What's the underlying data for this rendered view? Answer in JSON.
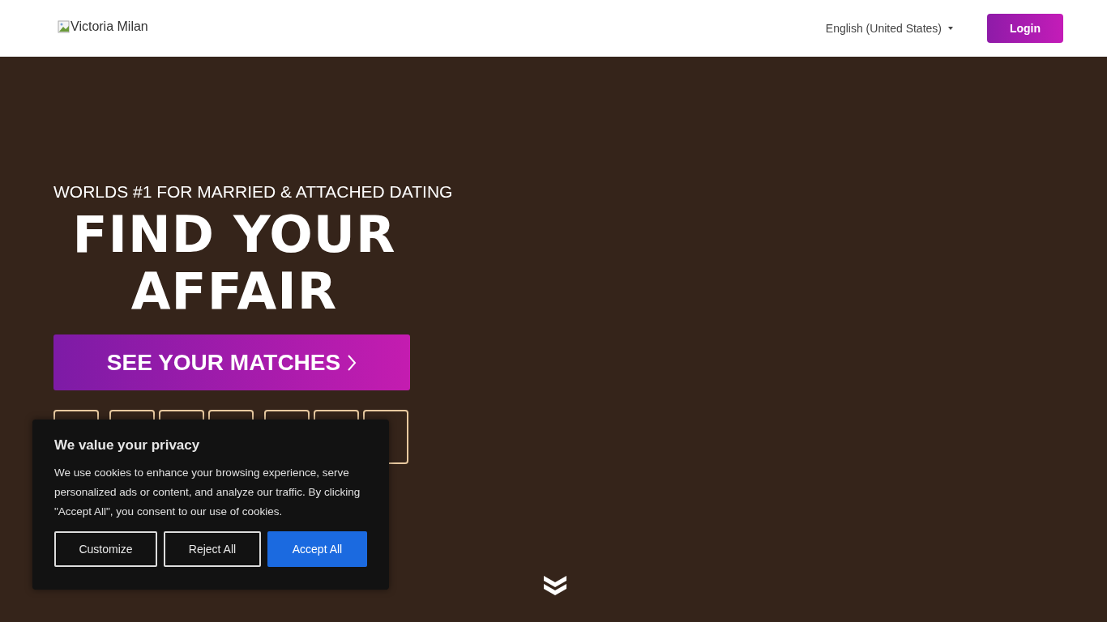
{
  "header": {
    "logo_alt": "Victoria Milan",
    "language": "English (United States)",
    "login": "Login"
  },
  "hero": {
    "tagline": "WORLDS #1 FOR MARRIED & ATTACHED DATING",
    "headline_lines": [
      "FIND YOUR",
      "AFFAIR"
    ],
    "cta": "SEE YOUR MATCHES"
  },
  "cookie_banner": {
    "title": "We value your privacy",
    "text": "We use cookies to enhance your browsing experience, serve personalized ads or content, and analyze our traffic. By clicking \"Accept All\", you consent to our use of cookies.",
    "buttons": [
      {
        "label": "Customize",
        "kind": "outline"
      },
      {
        "label": "Reject All",
        "kind": "outline"
      },
      {
        "label": "Accept All",
        "kind": "primary"
      }
    ]
  }
}
